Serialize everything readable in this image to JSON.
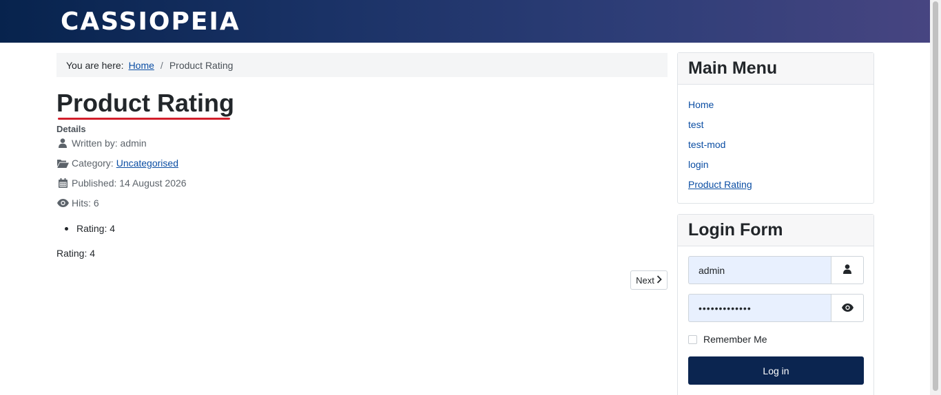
{
  "header": {
    "brand": "CASSIOPEIA"
  },
  "breadcrumb": {
    "prefix": "You are here:",
    "home": "Home",
    "separator": "/",
    "current": "Product Rating"
  },
  "article": {
    "title": "Product Rating",
    "details_label": "Details",
    "author": "Written by: admin",
    "category_prefix": "Category:",
    "category_link": "Uncategorised",
    "published": "Published: 14 August 2026",
    "hits": "Hits: 6",
    "rating_list_item": "Rating: 4",
    "rating_text": "Rating: 4",
    "next_label": "Next"
  },
  "main_menu": {
    "title": "Main Menu",
    "items": [
      "Home",
      "test",
      "test-mod",
      "login",
      "Product Rating"
    ]
  },
  "login_form": {
    "title": "Login Form",
    "username": "admin",
    "password_masked": "•••••••••••••",
    "remember_label": "Remember Me",
    "login_button": "Log in"
  },
  "colors": {
    "accent": "#0a4da3",
    "header_start": "#07234d",
    "header_end": "#474581",
    "button": "#0b2550",
    "title_underline": "#d31e2b"
  }
}
